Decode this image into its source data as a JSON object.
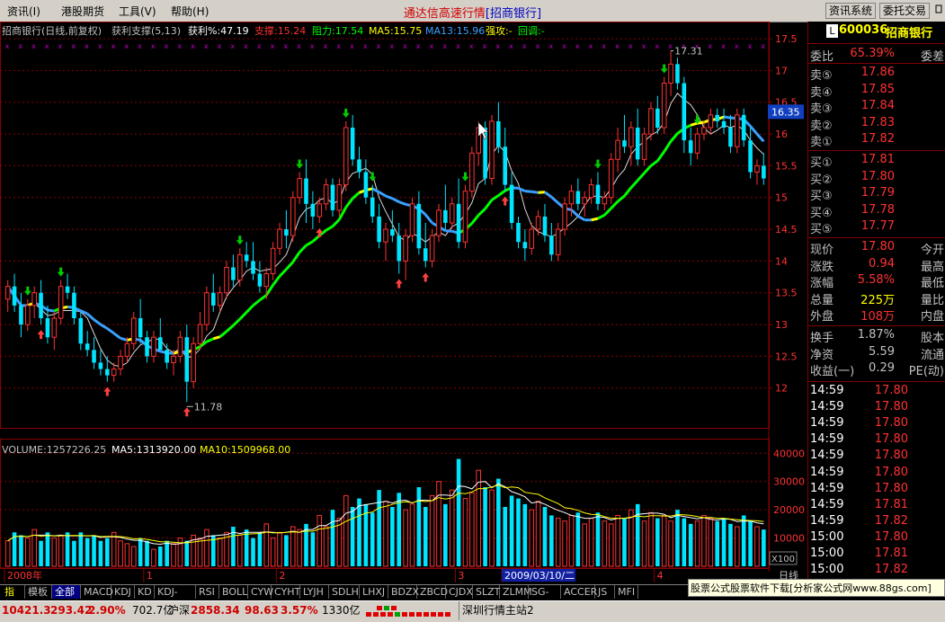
{
  "menu": {
    "items": [
      "资讯(I)",
      "港股期货",
      "工具(V)",
      "帮助(H)"
    ],
    "title": "通达信高速行情",
    "title_stock": "[招商银行]",
    "btn_info": "资讯系统",
    "btn_trade": "委托交易"
  },
  "header": {
    "name": "招商银行(日线,前复权)",
    "indicator": "获利支撑(5,13)",
    "profit": "获利%:47.19",
    "support": "支撑:15.24",
    "resist": "阻力:17.54",
    "ma5": "MA5:15.75",
    "ma13": "MA13:15.96",
    "strong": "强攻:-",
    "pullback": "回调:-"
  },
  "colors": {
    "up": "#ff3232",
    "down": "#00e5ff",
    "grid": "#8b0000",
    "axis_text": "#c0c0c0",
    "ma5": "#d8d8d8",
    "ma13_up": "#00ff00",
    "ma13_mid": "#ffff00",
    "ma13_down": "#3aa0ff",
    "vol_ma5": "#ffffff",
    "vol_ma10": "#ffff00",
    "signal_up": "#ff4040",
    "signal_down": "#00cc00"
  },
  "chart_data": [
    {
      "type": "candlestick",
      "title": "招商银行(日线,前复权)",
      "ylim": [
        11.6,
        17.6
      ],
      "yticks": [
        17.5,
        17.0,
        16.5,
        16.0,
        15.5,
        15.0,
        14.5,
        14.0,
        13.5,
        13.0,
        12.5,
        12.0
      ],
      "current_price_label": "16.35",
      "high_label": "17.31",
      "low_label": "11.78",
      "x_labels": [
        {
          "text": "2008年",
          "index": 0
        },
        {
          "text": "1",
          "index": 21
        },
        {
          "text": "2",
          "index": 41
        },
        {
          "text": "3",
          "index": 68
        },
        {
          "text": "2009/03/10/二",
          "index": 75
        },
        {
          "text": "4",
          "index": 98
        }
      ],
      "ohlc": [
        [
          13.4,
          13.7,
          13.2,
          13.6
        ],
        [
          13.6,
          13.8,
          13.2,
          13.3
        ],
        [
          13.3,
          13.5,
          12.8,
          13.0
        ],
        [
          13.0,
          13.4,
          12.9,
          13.3
        ],
        [
          13.3,
          13.6,
          13.1,
          13.5
        ],
        [
          13.5,
          13.7,
          13.0,
          13.1
        ],
        [
          13.1,
          13.3,
          12.7,
          12.8
        ],
        [
          12.8,
          13.2,
          12.6,
          13.1
        ],
        [
          13.1,
          13.7,
          13.0,
          13.6
        ],
        [
          13.6,
          13.8,
          13.4,
          13.5
        ],
        [
          13.5,
          13.6,
          13.0,
          13.1
        ],
        [
          13.1,
          13.2,
          12.6,
          12.7
        ],
        [
          12.7,
          12.9,
          12.5,
          12.6
        ],
        [
          12.6,
          12.8,
          12.3,
          12.4
        ],
        [
          12.4,
          12.6,
          12.2,
          12.3
        ],
        [
          12.3,
          12.5,
          12.1,
          12.2
        ],
        [
          12.2,
          12.4,
          12.1,
          12.3
        ],
        [
          12.3,
          12.6,
          12.2,
          12.5
        ],
        [
          12.5,
          12.8,
          12.4,
          12.7
        ],
        [
          12.7,
          13.2,
          12.6,
          13.1
        ],
        [
          13.1,
          13.4,
          12.7,
          12.8
        ],
        [
          12.8,
          12.9,
          12.4,
          12.5
        ],
        [
          12.5,
          12.9,
          12.4,
          12.8
        ],
        [
          12.8,
          13.1,
          12.6,
          12.6
        ],
        [
          12.6,
          12.7,
          12.3,
          12.4
        ],
        [
          12.4,
          12.6,
          12.2,
          12.5
        ],
        [
          12.5,
          12.9,
          12.4,
          12.8
        ],
        [
          12.8,
          13.0,
          11.78,
          12.1
        ],
        [
          12.1,
          12.8,
          12.0,
          12.7
        ],
        [
          12.7,
          13.2,
          12.6,
          13.0
        ],
        [
          13.0,
          13.6,
          12.9,
          13.5
        ],
        [
          13.5,
          13.8,
          13.2,
          13.3
        ],
        [
          13.3,
          13.6,
          13.2,
          13.5
        ],
        [
          13.5,
          14.0,
          13.4,
          13.9
        ],
        [
          13.9,
          14.1,
          13.6,
          13.7
        ],
        [
          13.7,
          14.2,
          13.6,
          14.1
        ],
        [
          14.1,
          14.3,
          13.9,
          14.0
        ],
        [
          14.0,
          14.3,
          13.7,
          13.8
        ],
        [
          13.8,
          14.0,
          13.5,
          13.6
        ],
        [
          13.6,
          13.9,
          13.4,
          13.8
        ],
        [
          13.8,
          14.3,
          13.7,
          14.2
        ],
        [
          14.2,
          14.6,
          14.1,
          14.5
        ],
        [
          14.5,
          14.8,
          14.2,
          14.4
        ],
        [
          14.4,
          15.1,
          14.3,
          15.0
        ],
        [
          15.0,
          15.4,
          14.9,
          15.3
        ],
        [
          15.3,
          15.6,
          14.6,
          14.9
        ],
        [
          14.9,
          15.1,
          14.5,
          14.7
        ],
        [
          14.7,
          15.0,
          14.6,
          14.9
        ],
        [
          14.9,
          15.3,
          14.8,
          15.2
        ],
        [
          15.2,
          15.3,
          14.7,
          14.8
        ],
        [
          14.8,
          15.3,
          14.7,
          15.2
        ],
        [
          15.2,
          16.2,
          15.1,
          16.1
        ],
        [
          16.1,
          16.3,
          15.5,
          15.6
        ],
        [
          15.6,
          15.8,
          15.3,
          15.4
        ],
        [
          15.4,
          15.6,
          14.9,
          15.0
        ],
        [
          15.0,
          15.2,
          14.6,
          14.7
        ],
        [
          14.7,
          14.9,
          14.2,
          14.3
        ],
        [
          14.3,
          14.6,
          14.0,
          14.5
        ],
        [
          14.5,
          14.8,
          14.3,
          14.4
        ],
        [
          14.4,
          14.6,
          13.8,
          14.0
        ],
        [
          14.0,
          14.5,
          13.7,
          14.4
        ],
        [
          14.4,
          15.0,
          14.3,
          14.9
        ],
        [
          14.9,
          15.1,
          14.1,
          14.2
        ],
        [
          14.2,
          14.6,
          13.9,
          14.0
        ],
        [
          14.0,
          14.5,
          13.9,
          14.4
        ],
        [
          14.4,
          14.9,
          14.3,
          14.8
        ],
        [
          14.8,
          15.2,
          14.5,
          14.6
        ],
        [
          14.6,
          15.0,
          14.5,
          14.9
        ],
        [
          14.9,
          15.3,
          14.2,
          14.3
        ],
        [
          14.3,
          15.2,
          14.2,
          15.1
        ],
        [
          15.1,
          15.8,
          15.0,
          15.7
        ],
        [
          15.7,
          16.2,
          15.5,
          16.1
        ],
        [
          16.1,
          16.2,
          15.2,
          15.3
        ],
        [
          15.3,
          16.3,
          15.2,
          16.2
        ],
        [
          16.2,
          16.5,
          15.7,
          15.8
        ],
        [
          15.8,
          16.1,
          15.1,
          15.2
        ],
        [
          15.2,
          15.4,
          14.5,
          14.6
        ],
        [
          14.6,
          14.7,
          14.2,
          14.3
        ],
        [
          14.3,
          14.5,
          14.0,
          14.2
        ],
        [
          14.2,
          14.6,
          14.1,
          14.5
        ],
        [
          14.5,
          14.8,
          14.4,
          14.7
        ],
        [
          14.7,
          14.9,
          14.3,
          14.4
        ],
        [
          14.4,
          14.6,
          14.0,
          14.1
        ],
        [
          14.1,
          14.6,
          14.0,
          14.5
        ],
        [
          14.5,
          15.0,
          14.4,
          14.9
        ],
        [
          14.9,
          15.2,
          14.7,
          15.1
        ],
        [
          15.1,
          15.3,
          14.8,
          14.9
        ],
        [
          14.9,
          15.1,
          14.7,
          15.0
        ],
        [
          15.0,
          15.3,
          14.9,
          15.2
        ],
        [
          15.2,
          15.4,
          14.8,
          14.9
        ],
        [
          14.9,
          15.1,
          14.8,
          15.0
        ],
        [
          15.0,
          15.7,
          14.9,
          15.6
        ],
        [
          15.6,
          16.1,
          15.4,
          15.9
        ],
        [
          15.9,
          16.3,
          15.7,
          15.8
        ],
        [
          15.8,
          16.2,
          15.5,
          16.1
        ],
        [
          16.1,
          16.4,
          15.5,
          15.6
        ],
        [
          15.6,
          16.1,
          15.5,
          16.0
        ],
        [
          16.0,
          16.5,
          15.9,
          16.4
        ],
        [
          16.4,
          16.6,
          16.0,
          16.1
        ],
        [
          16.1,
          16.9,
          16.0,
          16.8
        ],
        [
          16.8,
          17.31,
          16.6,
          17.1
        ],
        [
          17.1,
          17.2,
          16.7,
          16.8
        ],
        [
          16.8,
          16.9,
          15.7,
          15.9
        ],
        [
          15.9,
          16.1,
          15.5,
          15.7
        ],
        [
          15.7,
          16.1,
          15.6,
          16.0
        ],
        [
          16.0,
          16.2,
          15.9,
          16.1
        ],
        [
          16.1,
          16.4,
          16.0,
          16.3
        ],
        [
          16.3,
          16.4,
          16.1,
          16.2
        ],
        [
          16.2,
          16.4,
          16.0,
          16.1
        ],
        [
          16.1,
          16.3,
          15.7,
          15.8
        ],
        [
          15.8,
          16.4,
          15.7,
          16.3
        ],
        [
          16.3,
          16.4,
          15.8,
          15.9
        ],
        [
          15.9,
          16.1,
          15.3,
          15.4
        ],
        [
          15.4,
          15.6,
          15.2,
          15.5
        ],
        [
          15.5,
          15.7,
          15.2,
          15.3
        ]
      ],
      "signals_up": [
        5,
        15,
        27,
        47,
        59,
        63,
        75
      ],
      "signals_down": [
        3,
        8,
        35,
        44,
        51,
        55,
        69,
        89,
        99,
        104
      ]
    },
    {
      "type": "bar",
      "title": "VOLUME",
      "values_label": "VOLUME:1257226.25",
      "ma5_label": "MA5:1313920.00",
      "ma10_label": "MA10:1509968.00",
      "ylim": [
        0,
        42000
      ],
      "yticks": [
        40000,
        30000,
        20000,
        10000
      ],
      "unit_label": "X100",
      "volumes": [
        9000,
        12000,
        11000,
        10000,
        13000,
        9000,
        12000,
        10000,
        11000,
        12000,
        9000,
        12000,
        10000,
        11000,
        9000,
        10000,
        12000,
        9000,
        8000,
        7000,
        10000,
        9000,
        6000,
        7000,
        9000,
        8000,
        10000,
        9000,
        11000,
        10000,
        13000,
        11000,
        10000,
        12000,
        14000,
        11000,
        13000,
        10000,
        12000,
        15000,
        10000,
        12000,
        11000,
        14000,
        13000,
        15000,
        12000,
        18000,
        14000,
        20000,
        17000,
        25000,
        21000,
        24000,
        22000,
        19000,
        27000,
        23000,
        21000,
        26000,
        20000,
        22000,
        28000,
        21000,
        25000,
        30000,
        22000,
        27000,
        38000,
        24000,
        26000,
        34000,
        28000,
        27000,
        31000,
        21000,
        25000,
        24000,
        22000,
        20000,
        23000,
        21000,
        18000,
        17000,
        16000,
        18000,
        19000,
        15000,
        17000,
        19000,
        16000,
        15000,
        18000,
        17000,
        20000,
        22000,
        16000,
        19000,
        17000,
        18000,
        16000,
        20000,
        17000,
        15000,
        16000,
        18000,
        17000,
        16000,
        17000,
        15000,
        14000,
        18000,
        16000,
        14000,
        13000
      ]
    }
  ],
  "rpanel": {
    "code_badge": "L",
    "code": "600036",
    "name": "招商银行",
    "wb_label": "委比",
    "wb_val": "65.39%",
    "wc_label": "委差",
    "sell": [
      {
        "label": "卖⑤",
        "price": "17.86"
      },
      {
        "label": "卖④",
        "price": "17.85"
      },
      {
        "label": "卖③",
        "price": "17.84"
      },
      {
        "label": "卖②",
        "price": "17.83"
      },
      {
        "label": "卖①",
        "price": "17.82"
      }
    ],
    "buy": [
      {
        "label": "买①",
        "price": "17.81"
      },
      {
        "label": "买②",
        "price": "17.80"
      },
      {
        "label": "买③",
        "price": "17.79"
      },
      {
        "label": "买④",
        "price": "17.78"
      },
      {
        "label": "买⑤",
        "price": "17.77"
      }
    ],
    "quote": [
      {
        "label": "现价",
        "val": "17.80",
        "label2": "今开",
        "color": "#ff3232"
      },
      {
        "label": "涨跌",
        "val": "0.94",
        "label2": "最高",
        "color": "#ff3232"
      },
      {
        "label": "涨幅",
        "val": "5.58%",
        "label2": "最低",
        "color": "#ff3232"
      },
      {
        "label": "总量",
        "val": "225万",
        "label2": "量比",
        "color": "#ffff00"
      },
      {
        "label": "外盘",
        "val": "108万",
        "label2": "内盘",
        "color": "#ff3232"
      }
    ],
    "stats": [
      {
        "label": "换手",
        "val": "1.87%",
        "label2": "股本"
      },
      {
        "label": "净资",
        "val": "5.59",
        "label2": "流通"
      },
      {
        "label": "收益(一)",
        "val": "0.29",
        "label2": "PE(动)"
      }
    ],
    "ticks": [
      {
        "time": "14:59",
        "price": "17.80"
      },
      {
        "time": "14:59",
        "price": "17.80"
      },
      {
        "time": "14:59",
        "price": "17.80"
      },
      {
        "time": "14:59",
        "price": "17.80"
      },
      {
        "time": "14:59",
        "price": "17.80"
      },
      {
        "time": "14:59",
        "price": "17.80"
      },
      {
        "time": "14:59",
        "price": "17.80"
      },
      {
        "time": "14:59",
        "price": "17.81"
      },
      {
        "time": "14:59",
        "price": "17.82"
      },
      {
        "time": "15:00",
        "price": "17.80"
      },
      {
        "time": "15:00",
        "price": "17.81"
      },
      {
        "time": "15:00",
        "price": "17.82"
      }
    ],
    "period_label": "日线"
  },
  "tabs": [
    "指标",
    "模板",
    "全部",
    "MACD",
    "KDJ",
    "KD",
    "KDJ-TDX",
    "RSI",
    "BOLL",
    "CYW",
    "CYHT",
    "LYJH",
    "SDLH",
    "LHXJ",
    "BDZX",
    "ZBCD",
    "CJDX",
    "SLZT",
    "ZLMM",
    "SG-LB",
    "ACCER",
    "JS",
    "MFI"
  ],
  "ad_text": "股票公式股票软件下载[分析家公式网www.88gs.com]",
  "status": {
    "sh_index": "10421.3",
    "sh_chg": "293.42",
    "sh_pct": "2.90%",
    "sh_amt": "702.7亿",
    "sz_name": "沪深",
    "sz_index": "2858.34",
    "sz_chg": "98.63",
    "sz_pct": "3.57%",
    "sz_amt": "1330亿",
    "station": "深圳行情主站2"
  }
}
